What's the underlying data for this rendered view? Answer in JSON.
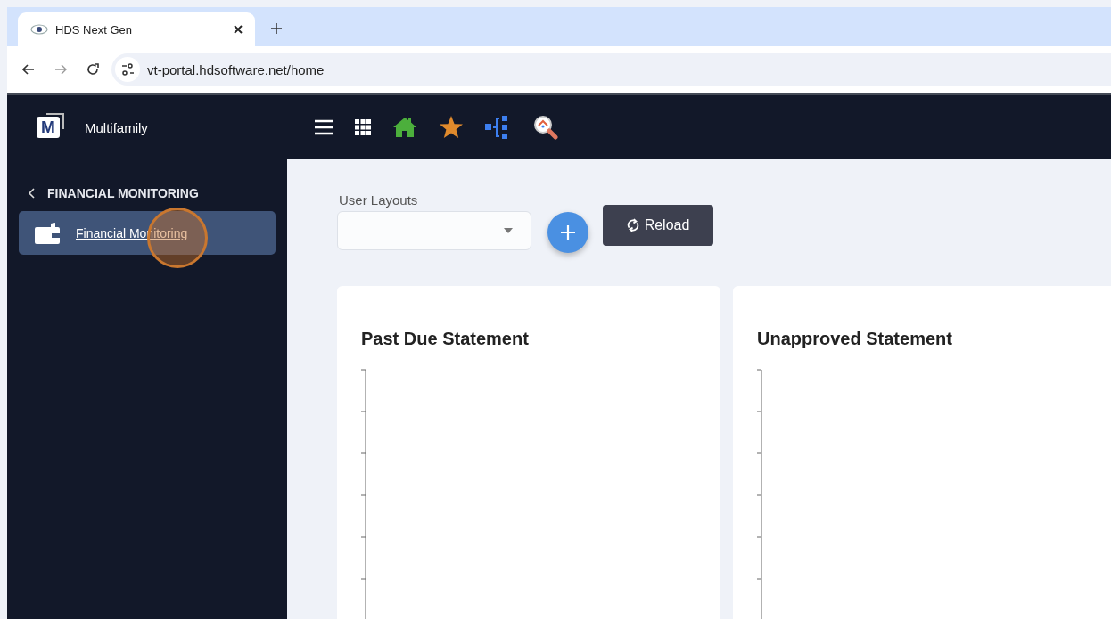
{
  "browser": {
    "tab": {
      "title": "HDS Next Gen"
    },
    "url": "vt-portal.hdsoftware.net/home"
  },
  "sidebar": {
    "logo": "M",
    "brand": "Multifamily",
    "section": "FINANCIAL MONITORING",
    "items": [
      {
        "label": "Financial Monitoring",
        "selected": true
      }
    ]
  },
  "layout_select": {
    "label": "User Layouts"
  },
  "reload_button": {
    "label": "Reload"
  },
  "cards": [
    {
      "title": "Past Due Statement"
    },
    {
      "title": "Unapproved Statement"
    }
  ]
}
